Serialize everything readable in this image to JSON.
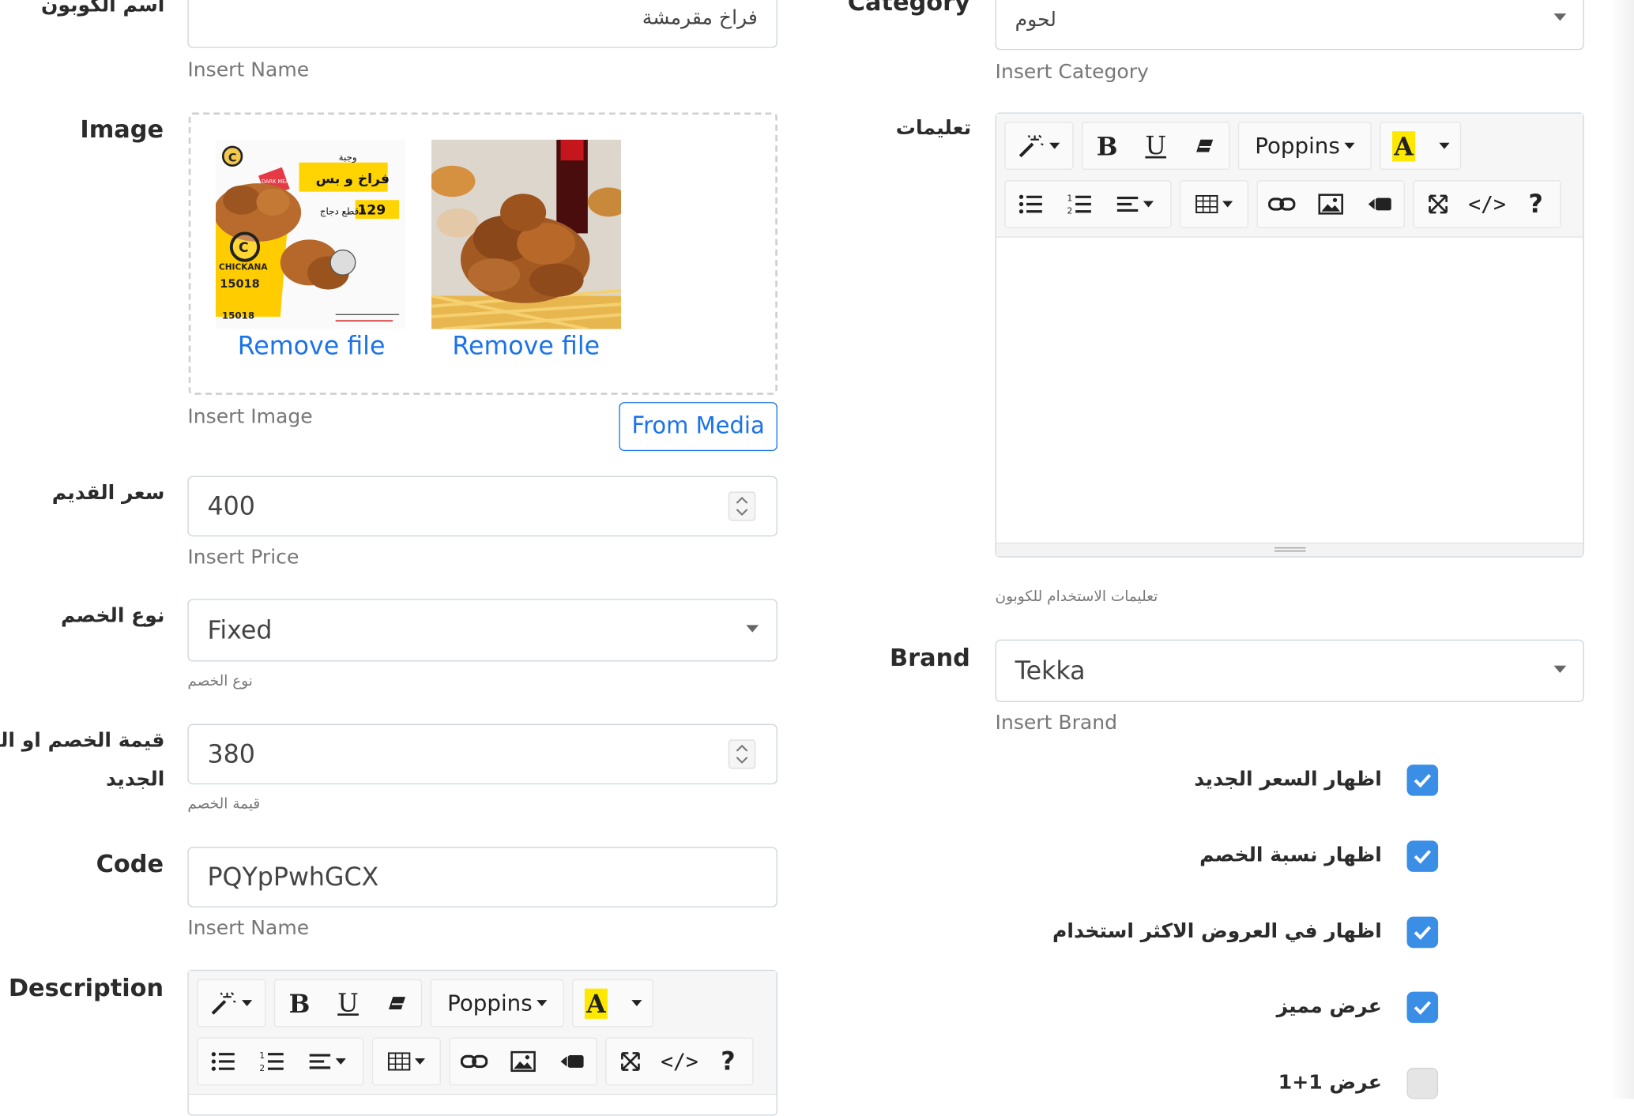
{
  "left": {
    "name": {
      "label": "اسم الكوبون",
      "value": "فراخ مقرمشة",
      "help": "Insert Name"
    },
    "image": {
      "label": "Image",
      "remove_1": "Remove file",
      "remove_2": "Remove file",
      "help": "Insert Image",
      "from_media": "From Media",
      "poster_texts": {
        "meal": "وجبة",
        "title": "فراخ و بس",
        "price": "129",
        "pieces": "١٠ قطع دجاج",
        "brand": "CHICKANA",
        "phone": "15018",
        "badge": "DARK MEAT"
      }
    },
    "old_price": {
      "label": "سعر القديم",
      "value": "400",
      "help": "Insert Price"
    },
    "discount_type": {
      "label": "نوع الخصم",
      "value": "Fixed",
      "help": "نوع الخصم"
    },
    "discount_value": {
      "label_1": "قيمة الخصم او السعر",
      "label_2": "الجديد",
      "value": "380",
      "help": "قيمة الخصم"
    },
    "code": {
      "label": "Code",
      "value": "PQYpPwhGCX",
      "help": "Insert Name"
    },
    "description": {
      "label": "Description",
      "font": "Poppins"
    }
  },
  "right": {
    "category": {
      "label": "Category",
      "value": "لحوم",
      "help": "Insert Category"
    },
    "instructions": {
      "label": "تعليمات",
      "font": "Poppins",
      "help": "تعليمات الاستخدام للكوبون"
    },
    "brand": {
      "label": "Brand",
      "value": "Tekka",
      "help": "Insert Brand"
    },
    "checks": [
      {
        "label": "اظهار السعر الجديد",
        "checked": true
      },
      {
        "label": "اظهار نسبة الخصم",
        "checked": true
      },
      {
        "label": "اظهار في العروض الاكثر استخدام",
        "checked": true
      },
      {
        "label": "عرض مميز",
        "checked": true
      },
      {
        "label": "عرض 1+1",
        "checked": false
      }
    ]
  },
  "toolbar": {
    "bold": "B",
    "underline": "U",
    "color_letter": "A",
    "help": "?"
  },
  "colors": {
    "accent": "#1a73e8",
    "check": "#3a8ee6",
    "highlight": "#ffe800"
  }
}
